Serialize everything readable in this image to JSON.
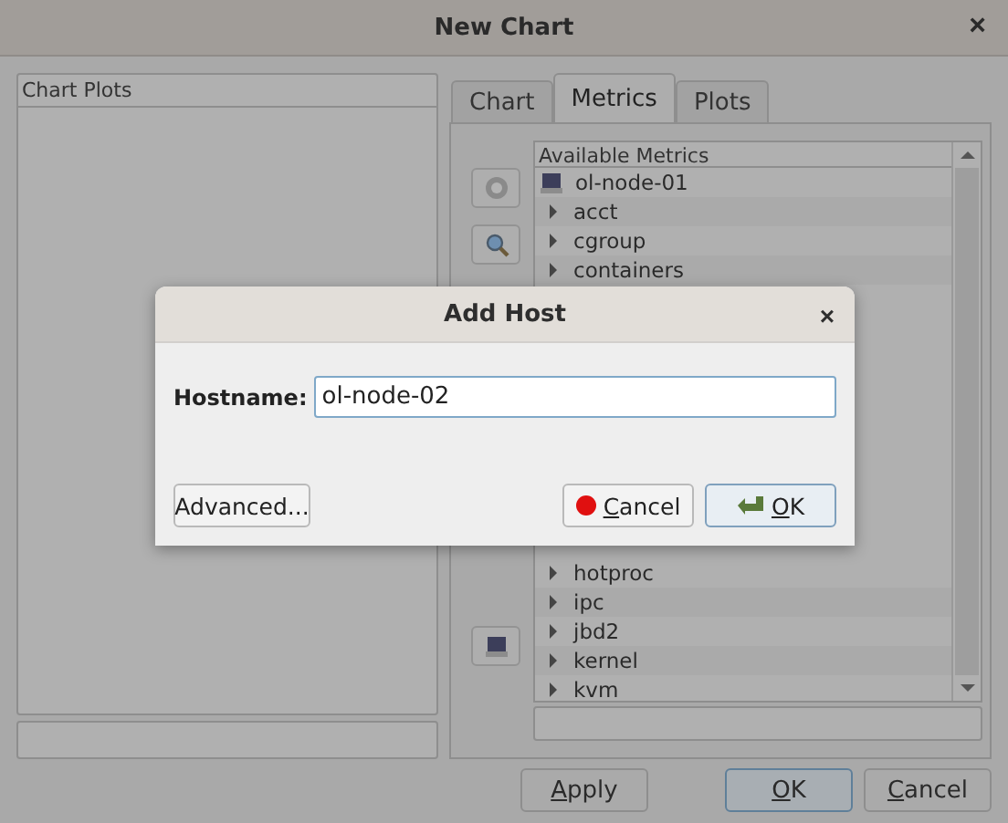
{
  "window": {
    "title": "New Chart",
    "close": "×"
  },
  "chart_plots": {
    "header": "Chart Plots"
  },
  "tabs": [
    {
      "label": "Chart",
      "selected": false
    },
    {
      "label": "Metrics",
      "selected": true
    },
    {
      "label": "Plots",
      "selected": false
    }
  ],
  "metrics": {
    "header": "Available Metrics",
    "host": "ol-node-01",
    "items": [
      "acct",
      "cgroup",
      "containers",
      "hotproc",
      "ipc",
      "jbd2",
      "kernel",
      "kvm"
    ]
  },
  "buttons": [
    {
      "label": "Apply",
      "kind": "plain"
    },
    {
      "label": "OK",
      "kind": "default"
    },
    {
      "label": "Cancel",
      "kind": "plain"
    }
  ],
  "dialog": {
    "title": "Add Host",
    "close": "×",
    "label": "Hostname:",
    "value": "ol-node-02",
    "buttons": [
      {
        "label": "Advanced...",
        "kind": "plain"
      },
      {
        "label": "Cancel",
        "kind": "cancel"
      },
      {
        "label": "OK",
        "kind": "default"
      }
    ]
  }
}
